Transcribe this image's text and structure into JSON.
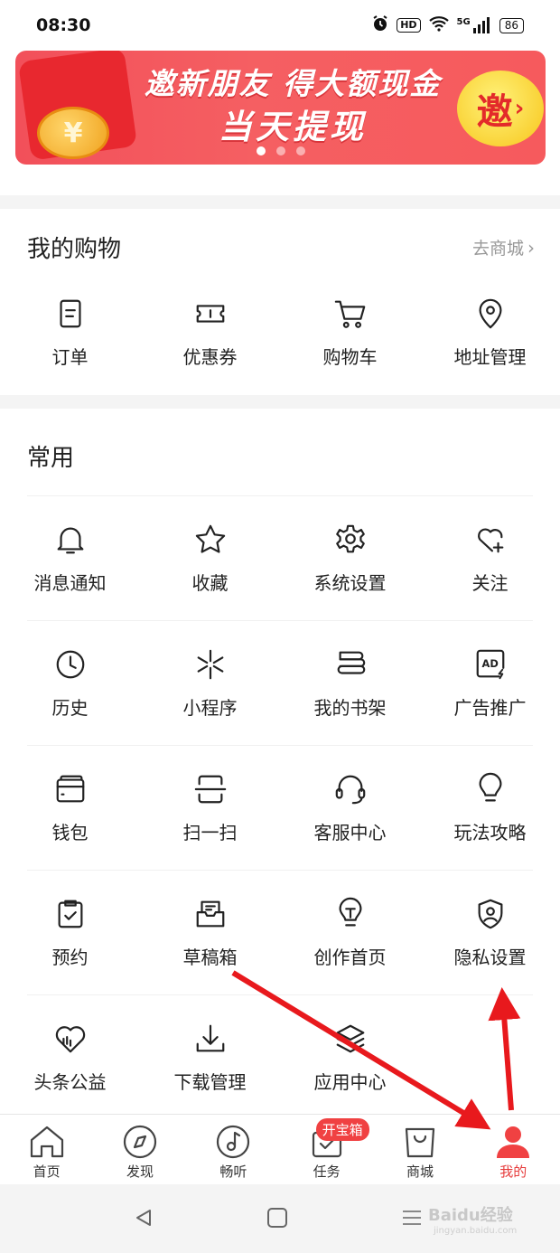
{
  "status_bar": {
    "time": "08:30",
    "hd_label": "HD",
    "network_label": "5G",
    "battery": "86"
  },
  "banner": {
    "line1": "邀新朋友 得大额现金",
    "line2": "当天提现",
    "invite_button": "邀",
    "coin_symbol": "¥",
    "slide_count": 3,
    "active_slide": 1
  },
  "shopping": {
    "title": "我的购物",
    "link": "去商城",
    "items": [
      {
        "label": "订单",
        "icon": "order-icon"
      },
      {
        "label": "优惠券",
        "icon": "coupon-icon"
      },
      {
        "label": "购物车",
        "icon": "cart-icon"
      },
      {
        "label": "地址管理",
        "icon": "location-icon"
      }
    ]
  },
  "common": {
    "title": "常用",
    "items": [
      {
        "label": "消息通知",
        "icon": "bell-icon"
      },
      {
        "label": "收藏",
        "icon": "star-icon"
      },
      {
        "label": "系统设置",
        "icon": "gear-icon"
      },
      {
        "label": "关注",
        "icon": "heart-plus-icon"
      },
      {
        "label": "历史",
        "icon": "clock-icon"
      },
      {
        "label": "小程序",
        "icon": "mini-program-icon"
      },
      {
        "label": "我的书架",
        "icon": "bookshelf-icon"
      },
      {
        "label": "广告推广",
        "icon": "ad-icon"
      },
      {
        "label": "钱包",
        "icon": "wallet-icon"
      },
      {
        "label": "扫一扫",
        "icon": "scan-icon"
      },
      {
        "label": "客服中心",
        "icon": "headset-icon"
      },
      {
        "label": "玩法攻略",
        "icon": "lightbulb-icon"
      },
      {
        "label": "预约",
        "icon": "clipboard-check-icon"
      },
      {
        "label": "草稿箱",
        "icon": "draft-box-icon"
      },
      {
        "label": "创作首页",
        "icon": "creator-bulb-icon"
      },
      {
        "label": "隐私设置",
        "icon": "privacy-shield-icon"
      },
      {
        "label": "头条公益",
        "icon": "charity-heart-icon"
      },
      {
        "label": "下载管理",
        "icon": "download-icon"
      },
      {
        "label": "应用中心",
        "icon": "layers-icon"
      }
    ]
  },
  "ad_icon_text": "AD",
  "tabs": [
    {
      "label": "首页",
      "icon": "home-icon"
    },
    {
      "label": "发现",
      "icon": "compass-icon"
    },
    {
      "label": "畅听",
      "icon": "music-note-icon"
    },
    {
      "label": "任务",
      "icon": "task-icon",
      "badge": "开宝箱"
    },
    {
      "label": "商城",
      "icon": "shopping-bag-icon"
    },
    {
      "label": "我的",
      "icon": "profile-icon",
      "active": true
    }
  ],
  "watermark": {
    "text": "Baidu经验",
    "sub": "jingyan.baidu.com"
  },
  "colors": {
    "accent": "#e63b3b",
    "banner": "#f55f62",
    "arrow": "#e8191d"
  }
}
